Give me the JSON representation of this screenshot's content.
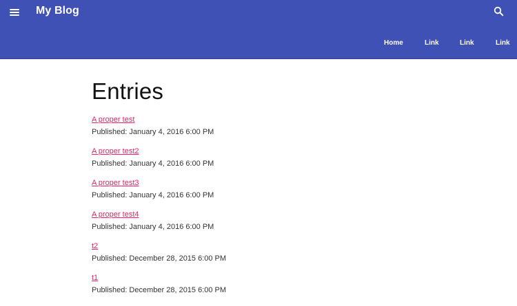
{
  "header": {
    "title": "My Blog",
    "menu_icon": "hamburger-menu-icon",
    "search_icon": "search-icon",
    "background_color": "#3f51b5",
    "nav": [
      {
        "label": "Home"
      },
      {
        "label": "Link"
      },
      {
        "label": "Link"
      },
      {
        "label": "Link"
      }
    ]
  },
  "main": {
    "heading": "Entries",
    "link_color": "#e91e63",
    "entries": [
      {
        "title": "A proper test",
        "published": "Published: January 4, 2016 6:00 PM"
      },
      {
        "title": "A proper test2",
        "published": "Published: January 4, 2016 6:00 PM"
      },
      {
        "title": "A proper test3",
        "published": "Published: January 4, 2016 6:00 PM"
      },
      {
        "title": "A proper test4",
        "published": "Published: January 4, 2016 6:00 PM"
      },
      {
        "title": "t2",
        "published": "Published: December 28, 2015 6:00 PM"
      },
      {
        "title": "t1",
        "published": "Published: December 28, 2015 6:00 PM"
      }
    ]
  }
}
